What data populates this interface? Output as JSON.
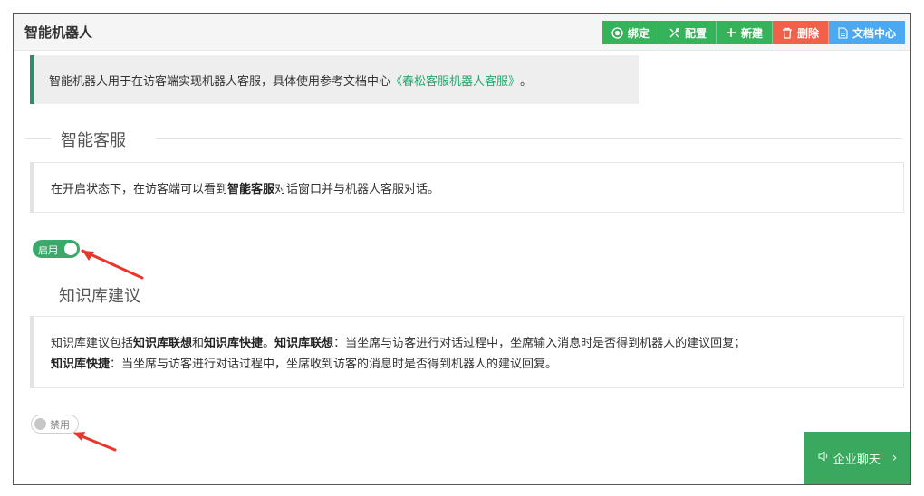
{
  "header": {
    "title": "智能机器人",
    "buttons": [
      {
        "label": "绑定",
        "icon": "target-icon",
        "color": "#35b35a"
      },
      {
        "label": "配置",
        "icon": "tools-icon",
        "color": "#35b35a"
      },
      {
        "label": "新建",
        "icon": "plus-icon",
        "color": "#35b35a"
      },
      {
        "label": "删除",
        "icon": "trash-icon",
        "color": "#f16048"
      },
      {
        "label": "文档中心",
        "icon": "document-icon",
        "color": "#4aa9f1"
      }
    ]
  },
  "info": {
    "text_prefix": "智能机器人用于在访客端实现机器人客服，具体使用参考文档中心",
    "link": "《春松客服机器人客服》",
    "text_suffix": "。"
  },
  "section_smart": {
    "title": "智能客服",
    "desc_prefix": "在开启状态下，在访客端可以看到",
    "desc_bold": "智能客服",
    "desc_suffix": "对话窗口并与机器人客服对话。",
    "switch_label": "启用",
    "switch_on": true
  },
  "section_kb": {
    "title": "知识库建议",
    "line1_a": "知识库建议包括",
    "line1_b": "知识库联想",
    "line1_c": "和",
    "line1_d": "知识库快捷",
    "line1_e": "。",
    "line1_f": "知识库联想",
    "line1_g": "：当坐席与访客进行对话过程中，坐席输入消息时是否得到机器人的建议回复；",
    "line2_a": "知识库快捷",
    "line2_b": "：当坐席与访客进行对话过程中，坐席收到访客的消息时是否得到机器人的建议回复。",
    "switch_label": "禁用",
    "switch_on": false
  },
  "chat_widget": {
    "label": "企业聊天",
    "icon": "speaker-icon",
    "caret": "›"
  },
  "colors": {
    "accent_green": "#35b35a",
    "delete_red": "#f16048",
    "docs_blue": "#4aa9f1",
    "info_border": "#2d8e6d",
    "link": "#2aa66d",
    "annotation_arrow": "#e8362b"
  }
}
